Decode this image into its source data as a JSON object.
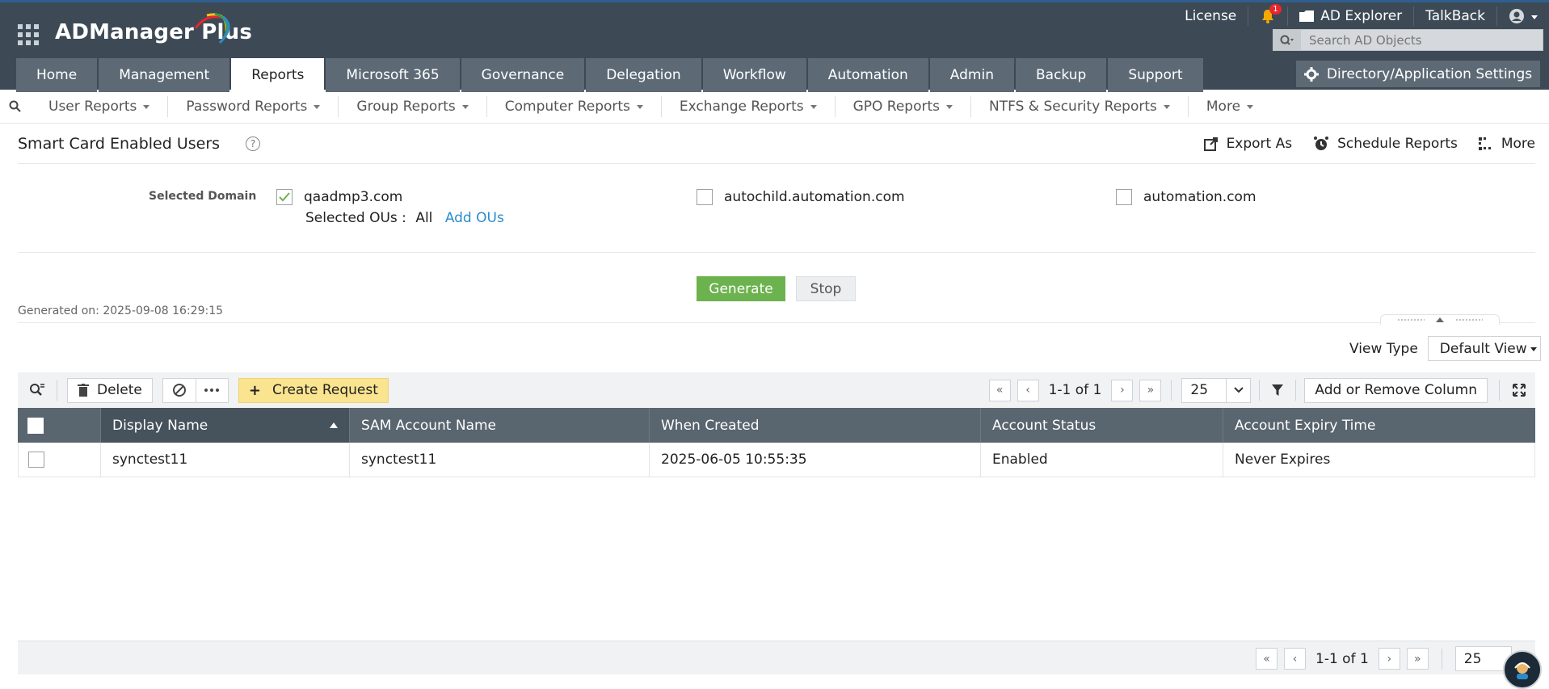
{
  "header": {
    "app_name": "ADManager Plus",
    "links": {
      "license": "License",
      "notification_count": "1",
      "ad_explorer": "AD Explorer",
      "talkback": "TalkBack"
    },
    "search": {
      "placeholder": "Search AD Objects"
    },
    "tabs": [
      "Home",
      "Management",
      "Reports",
      "Microsoft 365",
      "Governance",
      "Delegation",
      "Workflow",
      "Automation",
      "Admin",
      "Backup",
      "Support"
    ],
    "active_tab": "Reports",
    "settings_label": "Directory/Application Settings"
  },
  "subnav": {
    "items": [
      "User Reports",
      "Password Reports",
      "Group Reports",
      "Computer Reports",
      "Exchange Reports",
      "GPO Reports",
      "NTFS & Security Reports",
      "More"
    ]
  },
  "report": {
    "title": "Smart Card Enabled Users",
    "actions": {
      "export": "Export As",
      "schedule": "Schedule Reports",
      "more": "More"
    },
    "domain_label": "Selected Domain",
    "domains": [
      {
        "name": "qaadmp3.com",
        "checked": true
      },
      {
        "name": "autochild.automation.com",
        "checked": false
      },
      {
        "name": "automation.com",
        "checked": false
      }
    ],
    "selected_ous_label": "Selected OUs :",
    "selected_ous_value": "All",
    "add_ous": "Add OUs",
    "generate": "Generate",
    "stop": "Stop",
    "generated_on": "Generated on: 2025-09-08 16:29:15",
    "view_type_label": "View Type",
    "view_type_value": "Default View"
  },
  "toolbar": {
    "delete": "Delete",
    "create_request": "Create Request",
    "page_info": "1-1 of 1",
    "page_size": "25",
    "add_remove_column": "Add or Remove Column"
  },
  "table": {
    "columns": [
      "Display Name",
      "SAM Account Name",
      "When Created",
      "Account Status",
      "Account Expiry Time"
    ],
    "sorted_column": "Display Name",
    "rows": [
      [
        "synctest11",
        "synctest11",
        "2025-06-05 10:55:35",
        "Enabled",
        "Never Expires"
      ]
    ]
  },
  "footer": {
    "page_info": "1-1 of 1",
    "page_size": "25"
  },
  "colors": {
    "header_bg": "#3d4a56",
    "tab_bg": "#5d6a76",
    "generate_green": "#6cb24e",
    "create_request_yellow": "#fbe48f",
    "table_header": "#59656f",
    "link_blue": "#2b8ccc"
  }
}
